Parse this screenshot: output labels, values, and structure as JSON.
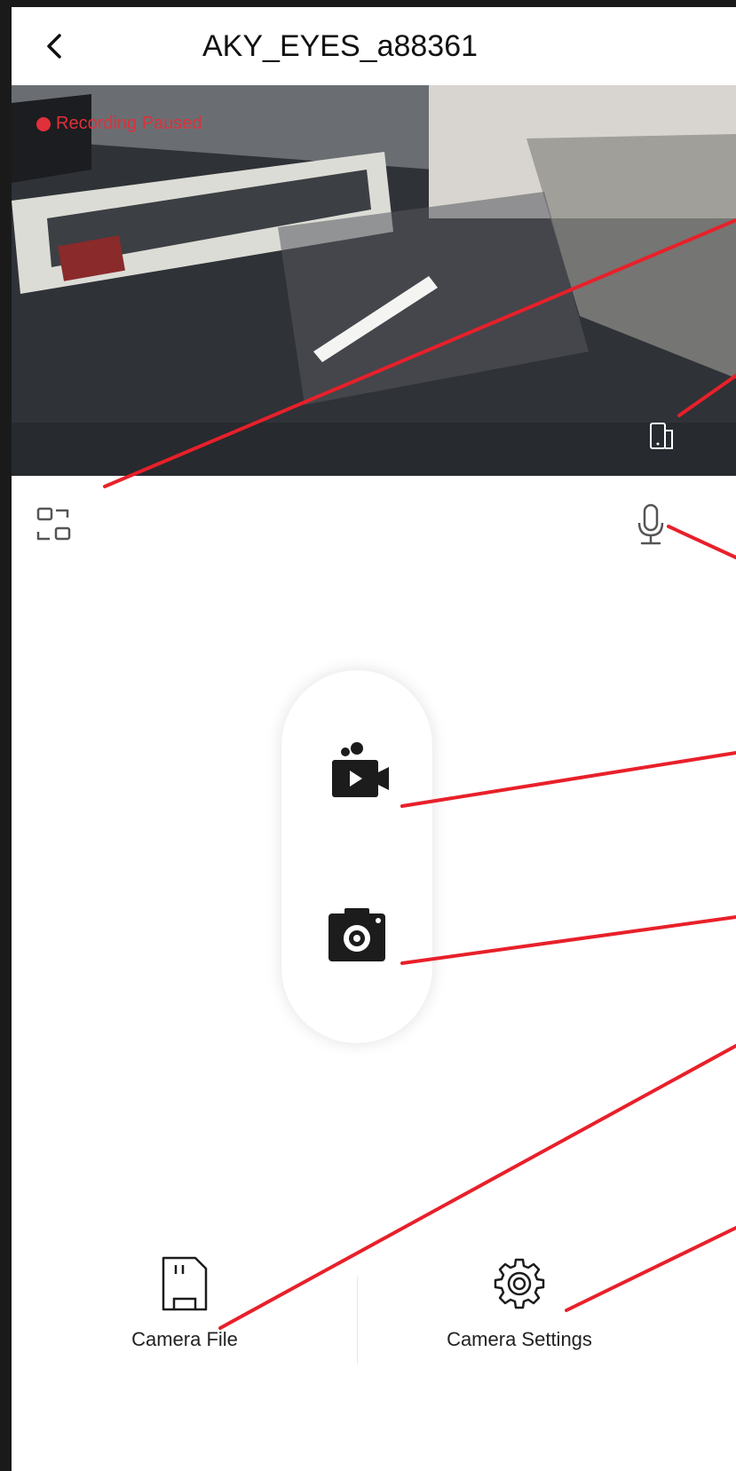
{
  "header": {
    "title": "AKY_EYES_a88361",
    "back_icon": "chevron-left-icon"
  },
  "preview": {
    "status_text": "Recording Paused",
    "status_color": "#e0303a"
  },
  "controls": {
    "fullscreen_icon": "fullscreen-toggle-icon",
    "orientation_icon": "rotate-screen-icon",
    "microphone_icon": "microphone-icon",
    "record_video_icon": "video-camera-icon",
    "take_photo_icon": "photo-camera-icon"
  },
  "bottom_nav": [
    {
      "label": "Camera File",
      "icon": "sd-card-icon"
    },
    {
      "label": "Camera Settings",
      "icon": "gear-icon"
    }
  ],
  "colors": {
    "accent": "#e0303a",
    "icon": "#1c1c1c",
    "annotation_line": "#e8202a"
  }
}
